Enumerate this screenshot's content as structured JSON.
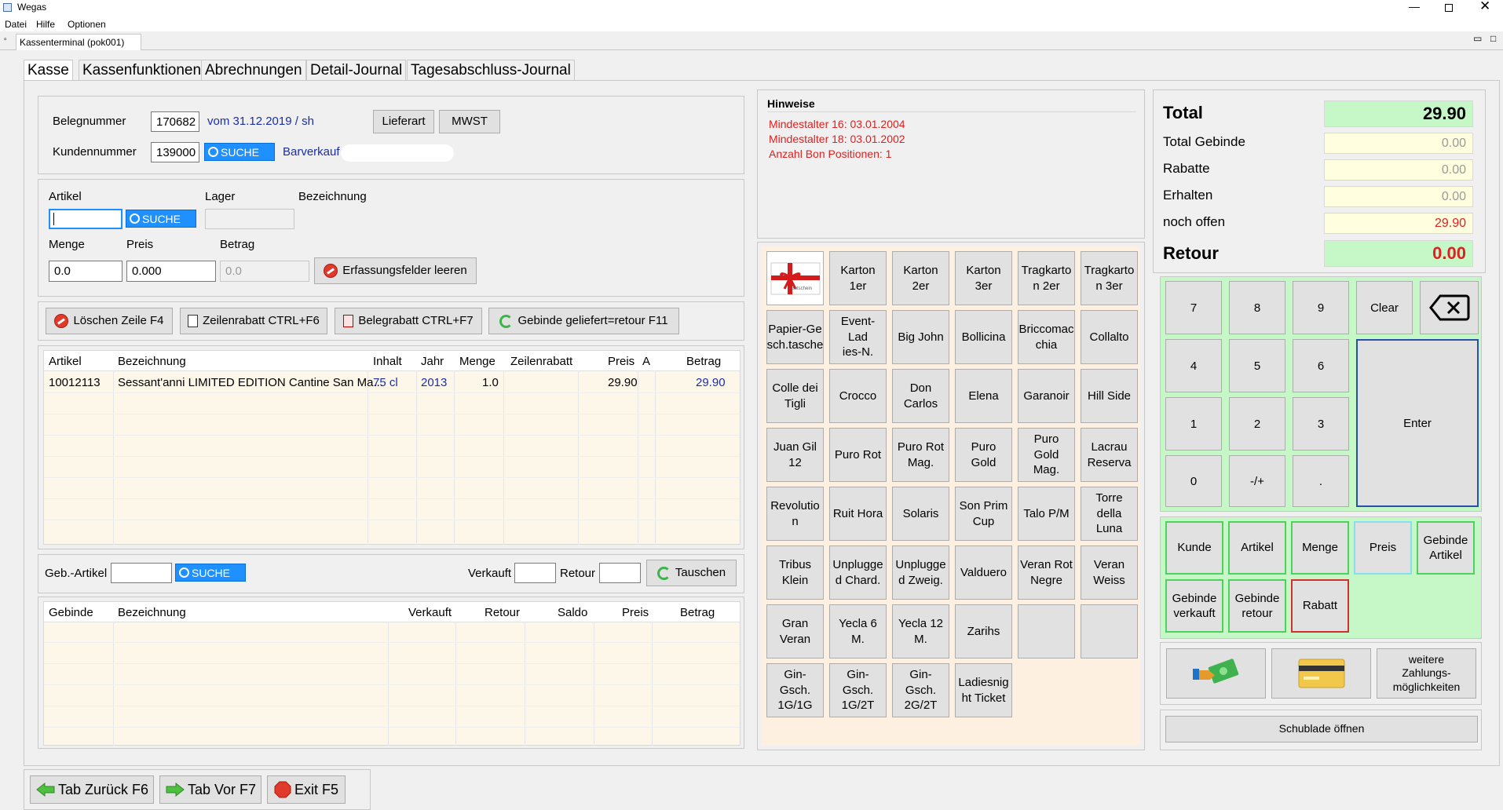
{
  "window": {
    "title": "Wegas",
    "menu": [
      "Datei",
      "Hilfe",
      "Optionen"
    ]
  },
  "editor_tab": "Kassenterminal (pok001)",
  "tabs": [
    "Kasse",
    "Kassenfunktionen",
    "Abrechnungen",
    "Detail-Journal",
    "Tagesabschluss-Journal"
  ],
  "beleg": {
    "belegnummer_label": "Belegnummer",
    "belegnummer": "170682",
    "datum": "vom 31.12.2019 / sh",
    "lieferart": "Lieferart",
    "mwst": "MWST",
    "kundennummer_label": "Kundennummer",
    "kundennummer": "139000",
    "suche": "SUCHE",
    "barverkauf": "Barverkauf"
  },
  "erfassung": {
    "artikel_label": "Artikel",
    "artikel_value": "",
    "suche": "SUCHE",
    "lager_label": "Lager",
    "bezeichnung_label": "Bezeichnung",
    "menge_label": "Menge",
    "menge": "0.0",
    "preis_label": "Preis",
    "preis": "0.000",
    "betrag_label": "Betrag",
    "betrag": "0.0",
    "leeren": "Erfassungsfelder leeren"
  },
  "actions": {
    "loeschen": "Löschen Zeile F4",
    "zeilenrabatt": "Zeilenrabatt CTRL+F6",
    "belegrabatt": "Belegrabatt CTRL+F7",
    "gebinde": "Gebinde geliefert=retour F11"
  },
  "positions": {
    "headers": [
      "Artikel",
      "Bezeichnung",
      "Inhalt",
      "Jahr",
      "Menge",
      "Zeilenrabatt",
      "Preis",
      "A",
      "Betrag"
    ],
    "rows": [
      {
        "artikel": "10012113",
        "bezeichnung": "Sessant'anni LIMITED EDITION Cantine San Ma...",
        "inhalt": "75 cl",
        "jahr": "2013",
        "menge": "1.0",
        "zeilenrabatt": "",
        "preis": "29.90",
        "a": "",
        "betrag": "29.90"
      }
    ]
  },
  "gebinde_form": {
    "label": "Geb.-Artikel",
    "suche": "SUCHE",
    "verkauft": "Verkauft",
    "retour": "Retour",
    "tauschen": "Tauschen"
  },
  "gebinde_table": {
    "headers": [
      "Gebinde",
      "Bezeichnung",
      "Verkauft",
      "Retour",
      "Saldo",
      "Preis",
      "Betrag"
    ]
  },
  "hinweise": {
    "title": "Hinweise",
    "lines": [
      "Mindestalter 16: 03.01.2004",
      "Mindestalter 18: 03.01.2002",
      "Anzahl Bon Positionen: 1"
    ],
    "color": "#e02020"
  },
  "products": {
    "gutschein": "Gutschein",
    "items": [
      "Karton 1er",
      "Karton 2er",
      "Karton 3er",
      "Tragkarton 2er",
      "Tragkarton 3er",
      "Papier-Geschenktasche",
      "Event-Ladies-N.",
      "Big John",
      "Bollicina",
      "Briccomacchia",
      "Collalto",
      "Colle dei Tigli",
      "Crocco",
      "Don Carlos",
      "Elena",
      "Garanoir",
      "Hill Side",
      "Juan Gil 12",
      "Puro Rot",
      "Puro Rot Mag.",
      "Puro Gold",
      "Puro Gold Mag.",
      "Lacrau Reserva",
      "Revolution",
      "Ruit Hora",
      "Solaris",
      "Son Prim Cup",
      "Talo P/M",
      "Torre della Luna",
      "Tribus Klein",
      "Unplugged Chard.",
      "Unplugged Zweig.",
      "Valduero",
      "Veran Rot Negre",
      "Veran Weiss",
      "Gran Veran",
      "Yecla 6 M.",
      "Yecla 12 M.",
      "Zarihs",
      "",
      "",
      "Gin-Gsch. 1G/1G",
      "Gin-Gsch. 1G/2T",
      "Gin-Gsch. 2G/2T",
      "Ladiesnight Ticket"
    ],
    "display": [
      "",
      "Karton 1er",
      "Karton 2er",
      "Karton 3er",
      "Tragkarto\nn 2er",
      "Tragkarto\nn 3er",
      "Papier-Ge\nsch.tasche",
      "Event-Lad\nies-N.",
      "Big John",
      "Bollicina",
      "Briccomac\nchia",
      "Collalto",
      "Colle dei\nTigli",
      "Crocco",
      "Don\nCarlos",
      "Elena",
      "Garanoir",
      "Hill Side",
      "Juan Gil\n12",
      "Puro Rot",
      "Puro Rot\nMag.",
      "Puro Gold",
      "Puro Gold\nMag.",
      "Lacrau\nReserva",
      "Revolutio\nn",
      "Ruit Hora",
      "Solaris",
      "Son Prim\nCup",
      "Talo P/M",
      "Torre\ndella Luna",
      "Tribus\nKlein",
      "Unplugge\nd Chard.",
      "Unplugge\nd Zweig.",
      "Valduero",
      "Veran Rot\nNegre",
      "Veran\nWeiss",
      "Gran\nVeran",
      "Yecla 6 M.",
      "Yecla 12\nM.",
      "Zarihs",
      "",
      "",
      "Gin-Gsch.\n1G/1G",
      "Gin-Gsch.\n1G/2T",
      "Gin-Gsch.\n2G/2T",
      "Ladiesnig\nht Ticket"
    ]
  },
  "totals": {
    "total_label": "Total",
    "total": "29.90",
    "total_gebinde_label": "Total Gebinde",
    "total_gebinde": "0.00",
    "rabatte_label": "Rabatte",
    "rabatte": "0.00",
    "erhalten_label": "Erhalten",
    "erhalten": "0.00",
    "noch_offen_label": "noch offen",
    "noch_offen": "29.90",
    "retour_label": "Retour",
    "retour": "0.00"
  },
  "keypad": {
    "keys": [
      "7",
      "8",
      "9",
      "4",
      "5",
      "6",
      "1",
      "2",
      "3",
      "0",
      "-/+",
      "."
    ],
    "clear": "Clear",
    "enter": "Enter"
  },
  "functions": {
    "kunde": "Kunde",
    "artikel": "Artikel",
    "menge": "Menge",
    "preis": "Preis",
    "gebinde_artikel": "Gebinde\nArtikel",
    "gebinde_verkauft": "Gebinde\nverkauft",
    "gebinde_retour": "Gebinde\nretour",
    "rabatt": "Rabatt"
  },
  "payment": {
    "weitere": "weitere\nZahlungs-\nmöglichkeiten",
    "schublade": "Schublade öffnen"
  },
  "bottom": {
    "tab_zurueck": "Tab Zurück F6",
    "tab_vor": "Tab Vor F7",
    "exit": "Exit F5"
  }
}
